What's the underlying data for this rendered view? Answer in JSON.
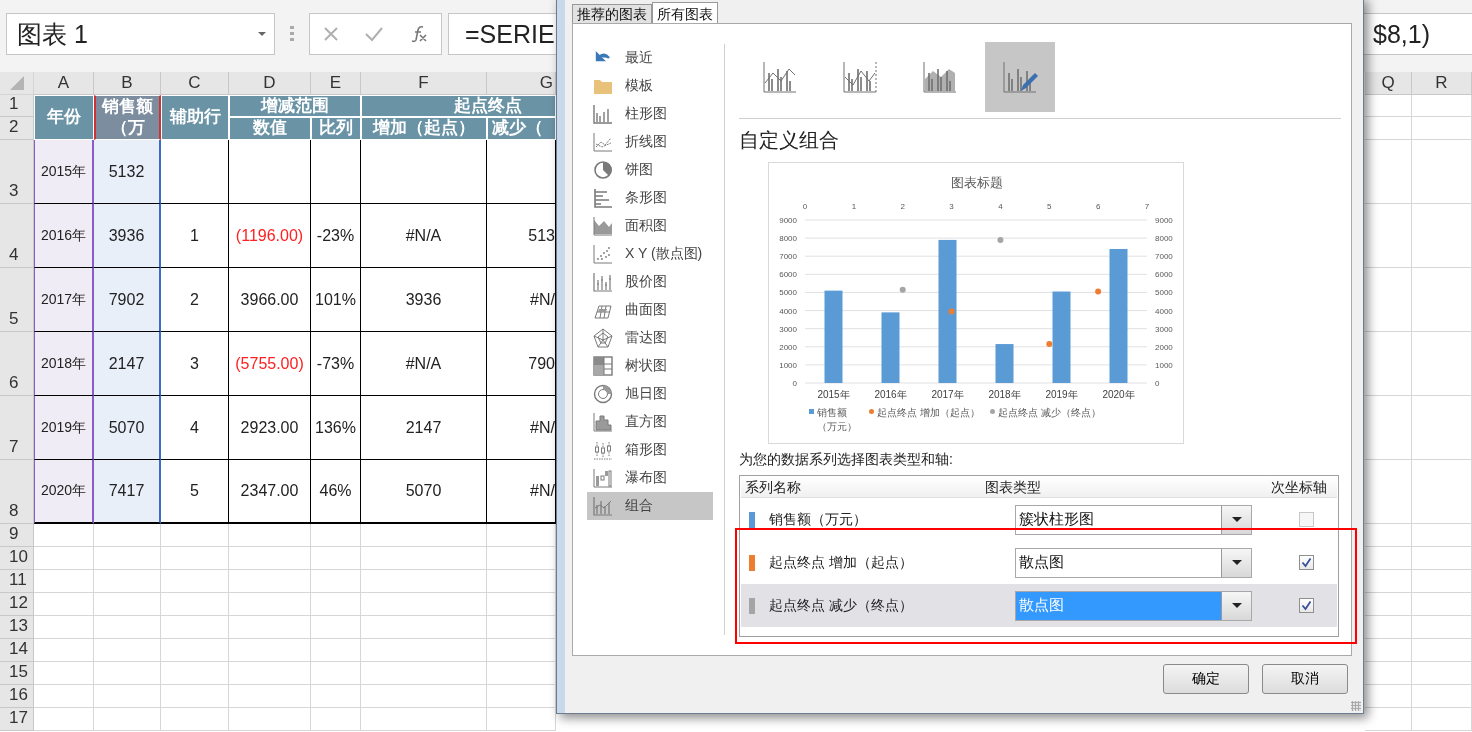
{
  "name_box": "图表 1",
  "formula_start": "=SERIE",
  "formula_end": "$8,1)",
  "columns": [
    "A",
    "B",
    "C",
    "D",
    "E",
    "F",
    "G",
    "Q",
    "R"
  ],
  "row_numbers": [
    "1",
    "2",
    "3",
    "4",
    "5",
    "6",
    "7",
    "8",
    "9",
    "10",
    "11",
    "12",
    "13",
    "14",
    "15",
    "16",
    "17"
  ],
  "headers": {
    "year": "年份",
    "sales": "销售额（万",
    "helper": "辅助行",
    "range": "增减范围",
    "value": "数值",
    "ratio": "比列",
    "endpoints": "起点终点",
    "increase": "增加（起点）",
    "decrease": "减少（"
  },
  "rows": [
    {
      "year": "2015年",
      "sales": "5132"
    },
    {
      "year": "2016年",
      "sales": "3936",
      "helper": "1",
      "value": "(1196.00)",
      "negative": true,
      "ratio": "-23%",
      "increase": "#N/A",
      "decrease": "513"
    },
    {
      "year": "2017年",
      "sales": "7902",
      "helper": "2",
      "value": "3966.00",
      "negative": false,
      "ratio": "101%",
      "increase": "3936",
      "decrease": "#N/"
    },
    {
      "year": "2018年",
      "sales": "2147",
      "helper": "3",
      "value": "(5755.00)",
      "negative": true,
      "ratio": "-73%",
      "increase": "#N/A",
      "decrease": "790"
    },
    {
      "year": "2019年",
      "sales": "5070",
      "helper": "4",
      "value": "2923.00",
      "negative": false,
      "ratio": "136%",
      "increase": "2147",
      "decrease": "#N/"
    },
    {
      "year": "2020年",
      "sales": "7417",
      "helper": "5",
      "value": "2347.00",
      "negative": false,
      "ratio": "46%",
      "increase": "5070",
      "decrease": "#N/"
    }
  ],
  "dialog": {
    "tabs": [
      {
        "label": "推荐的图表",
        "selected": false
      },
      {
        "label": "所有图表",
        "selected": true
      }
    ],
    "chart_types": [
      {
        "kind": "recent",
        "label": "最近",
        "selected": false
      },
      {
        "kind": "templates",
        "label": "模板",
        "selected": false
      },
      {
        "kind": "column",
        "label": "柱形图",
        "selected": false
      },
      {
        "kind": "line",
        "label": "折线图",
        "selected": false
      },
      {
        "kind": "pie",
        "label": "饼图",
        "selected": false
      },
      {
        "kind": "bar",
        "label": "条形图",
        "selected": false
      },
      {
        "kind": "area",
        "label": "面积图",
        "selected": false
      },
      {
        "kind": "scatter",
        "label": "X Y (散点图)",
        "selected": false
      },
      {
        "kind": "stock",
        "label": "股价图",
        "selected": false
      },
      {
        "kind": "surface",
        "label": "曲面图",
        "selected": false
      },
      {
        "kind": "radar",
        "label": "雷达图",
        "selected": false
      },
      {
        "kind": "treemap",
        "label": "树状图",
        "selected": false
      },
      {
        "kind": "sunburst",
        "label": "旭日图",
        "selected": false
      },
      {
        "kind": "histogram",
        "label": "直方图",
        "selected": false
      },
      {
        "kind": "box",
        "label": "箱形图",
        "selected": false
      },
      {
        "kind": "waterfall",
        "label": "瀑布图",
        "selected": false
      },
      {
        "kind": "combo",
        "label": "组合",
        "selected": true
      }
    ],
    "subtypes": [
      {
        "kind": "column-line",
        "selected": false
      },
      {
        "kind": "column-line-secondary",
        "selected": false
      },
      {
        "kind": "area-column",
        "selected": false
      },
      {
        "kind": "custom",
        "selected": true
      }
    ],
    "heading": "自定义组合",
    "preview": {
      "left_axis_labels": [
        "9000",
        "8000",
        "7000",
        "6000",
        "5000",
        "4000",
        "3000",
        "2000",
        "1000",
        "0"
      ],
      "top_axis_labels": [
        "0",
        "1",
        "2",
        "3",
        "4",
        "5",
        "6",
        "7"
      ],
      "right_axis_labels": [
        "9000",
        "8000",
        "7000",
        "6000",
        "5000",
        "4000",
        "3000",
        "2000",
        "1000",
        "0"
      ],
      "chart_data": {
        "type": "bar",
        "title": "图表标题",
        "grid": true,
        "legend": "bottom",
        "categories": [
          "2015年",
          "2016年",
          "2017年",
          "2018年",
          "2019年",
          "2020年"
        ],
        "ylim": [
          0,
          9000
        ],
        "yticks": [
          0,
          1000,
          2000,
          3000,
          4000,
          5000,
          6000,
          7000,
          8000,
          9000
        ],
        "series": [
          {
            "name": "销售额（万元）",
            "type": "bar",
            "color": "#5b9bd5",
            "values": [
              5100,
              3900,
              7900,
              2150,
              5050,
              7400
            ]
          },
          {
            "name": "起点终点 增加（起点）",
            "type": "scatter",
            "color": "#ed7d31",
            "values": [
              null,
              null,
              3950,
              null,
              2150,
              5050
            ]
          },
          {
            "name": "起点终点 减少（终点）",
            "type": "scatter",
            "color": "#a5a5a5",
            "values": [
              null,
              5150,
              null,
              7900,
              null,
              null
            ]
          }
        ]
      }
    },
    "series_prompt": "为您的数据系列选择图表类型和轴:",
    "series_table": {
      "columns": [
        "系列名称",
        "图表类型",
        "次坐标轴"
      ],
      "rows": [
        {
          "name": "销售额（万元）",
          "color": "#5b9bd5",
          "chart_type": "簇状柱形图",
          "secondary_axis": false,
          "disabled": true,
          "selected": false
        },
        {
          "name": "起点终点 增加（起点）",
          "color": "#ed7d31",
          "chart_type": "散点图",
          "secondary_axis": true,
          "disabled": false,
          "selected": false
        },
        {
          "name": "起点终点 减少（终点）",
          "color": "#a5a5a5",
          "chart_type": "散点图",
          "secondary_axis": true,
          "disabled": false,
          "selected": true
        }
      ]
    },
    "buttons": [
      "确定",
      "取消"
    ]
  }
}
